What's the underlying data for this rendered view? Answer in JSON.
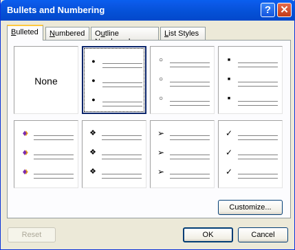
{
  "window": {
    "title": "Bullets and Numbering"
  },
  "titlebar": {
    "help_label": "?",
    "close_label": "✕"
  },
  "tabs": [
    {
      "key": "B",
      "rest": "ulleted",
      "active": true
    },
    {
      "key": "N",
      "rest": "umbered",
      "active": false
    },
    {
      "pre": "O",
      "key": "u",
      "rest": "tline Numbered",
      "active": false
    },
    {
      "key": "L",
      "rest": "ist Styles",
      "active": false
    }
  ],
  "bullets": {
    "none_label": "None",
    "styles": [
      {
        "name": "none",
        "glyph": ""
      },
      {
        "name": "solid-dot",
        "glyph": "●"
      },
      {
        "name": "hollow-circle",
        "glyph": "○"
      },
      {
        "name": "square",
        "glyph": "■"
      },
      {
        "name": "picture",
        "glyph": "♦"
      },
      {
        "name": "four-diamond",
        "glyph": "❖"
      },
      {
        "name": "arrow",
        "glyph": "➢"
      },
      {
        "name": "check",
        "glyph": "✓"
      }
    ]
  },
  "buttons": {
    "customize": "Customize...",
    "reset": "Reset",
    "ok": "OK",
    "cancel": "Cancel"
  },
  "colors": {
    "title_bar": "#0450D6",
    "selection_border": "#0A246A",
    "tab_accent": "#FFC83C"
  }
}
